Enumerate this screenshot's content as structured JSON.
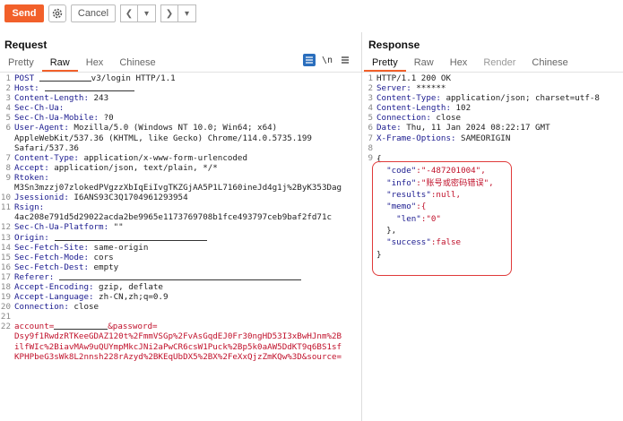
{
  "toolbar": {
    "send_label": "Send",
    "cancel_label": "Cancel",
    "icons": [
      "gear-icon",
      "back-arrow-icon",
      "back-dropdown-icon",
      "forward-arrow-icon",
      "forward-dropdown-icon"
    ]
  },
  "request": {
    "title": "Request",
    "tabs": [
      "Pretty",
      "Raw",
      "Hex",
      "Chinese"
    ],
    "active_tab": "Raw",
    "icons": [
      "wrap-lines-icon",
      "newline-icon",
      "menu-icon"
    ],
    "newline_label": "\\n",
    "line_numbers": [
      "1",
      "2",
      "3",
      "4",
      "5",
      "6",
      "",
      "",
      "7",
      "8",
      "9",
      "",
      "10",
      "11",
      "",
      "12",
      "13",
      "14",
      "15",
      "16",
      "17",
      "18",
      "19",
      "20",
      "21",
      "22",
      ""
    ],
    "lines": [
      {
        "k": "POST ",
        "v": "v3/login HTTP/1.1",
        "redact_before": 58
      },
      {
        "k": "Host:",
        "v": "",
        "redact_after": 100
      },
      {
        "k": "Content-Length:",
        "v": " 243"
      },
      {
        "k": "Sec-Ch-Ua:",
        "v": ""
      },
      {
        "k": "Sec-Ch-Ua-Mobile:",
        "v": " ?0"
      },
      {
        "k": "User-Agent:",
        "v": " Mozilla/5.0 (Windows NT 10.0; Win64; x64)"
      },
      {
        "k": "",
        "v": "AppleWebKit/537.36 (KHTML, like Gecko) Chrome/114.0.5735.199"
      },
      {
        "k": "",
        "v": "Safari/537.36"
      },
      {
        "k": "Content-Type:",
        "v": " application/x-www-form-urlencoded"
      },
      {
        "k": "Accept:",
        "v": " application/json, text/plain, */*"
      },
      {
        "k": "Rtoken:",
        "v": ""
      },
      {
        "k": "",
        "v": "M3Sn3mzzj07zlokedPVgzzXbIqEiIvgTKZGjAA5P1L7160ineJd4g1j%2ByK353Dag"
      },
      {
        "k": "Jsessionid:",
        "v": " I6ANS93C3Q1704961293954"
      },
      {
        "k": "Rsign:",
        "v": ""
      },
      {
        "k": "",
        "v": "4ac208e791d5d29022acda2be9965e1173769708b1fce493797ceb9baf2fd71c"
      },
      {
        "k": "Sec-Ch-Ua-Platform:",
        "v": " \"\""
      },
      {
        "k": "Origin:",
        "v": "",
        "redact_after": 170
      },
      {
        "k": "Sec-Fetch-Site:",
        "v": " same-origin"
      },
      {
        "k": "Sec-Fetch-Mode:",
        "v": " cors"
      },
      {
        "k": "Sec-Fetch-Dest:",
        "v": " empty"
      },
      {
        "k": "Referer:",
        "v": "",
        "redact_after": 270
      },
      {
        "k": "Accept-Encoding:",
        "v": " gzip, deflate"
      },
      {
        "k": "Accept-Language:",
        "v": " zh-CN,zh;q=0.9"
      },
      {
        "k": "Connection:",
        "v": " close"
      },
      {
        "k": "",
        "v": ""
      },
      {
        "k": "account=",
        "v": "&password=",
        "red": true,
        "redact_mid": 60
      },
      {
        "k": "",
        "v": "Dsy9f1RwdzRTKeeGDAZ120t%2FmmVSGp%2FvAsGqdEJ0Fr30ngHD53I3xBwHJnm%2B",
        "red": true
      },
      {
        "k": "",
        "v": "ilfWIc%2BiavMAw9uQUYmpMkcJNi2aPwCR6csW1Puck%2Bp5k0aAW5DdKT9q6BS1sf",
        "red": true
      },
      {
        "k": "",
        "v": "KPHPbeG3sWk8L2nnsh228rAzyd%2BKEqUbDX5%2BX%2FeXxQjzZmKQw%3D&source=",
        "red": true
      }
    ]
  },
  "response": {
    "title": "Response",
    "tabs": [
      "Pretty",
      "Raw",
      "Hex",
      "Render",
      "Chinese"
    ],
    "active_tab": "Pretty",
    "disabled_tab": "Render",
    "line_numbers": [
      "1",
      "2",
      "3",
      "4",
      "5",
      "6",
      "7",
      "8",
      "9"
    ],
    "headers": [
      {
        "k": "HTTP/1.1 200 OK",
        "v": ""
      },
      {
        "k": "Server:",
        "v": " ******"
      },
      {
        "k": "Content-Type:",
        "v": " application/json; charset=utf-8"
      },
      {
        "k": "Content-Length:",
        "v": " 102"
      },
      {
        "k": "Connection:",
        "v": " close"
      },
      {
        "k": "Date:",
        "v": " Thu, 11 Jan 2024 08:22:17 GMT"
      },
      {
        "k": "X-Frame-Options:",
        "v": " SAMEORIGIN"
      },
      {
        "k": "",
        "v": ""
      }
    ],
    "json_lines": [
      {
        "indent": "",
        "k": "{",
        "v": ""
      },
      {
        "indent": "  ",
        "k": "\"code\"",
        "v": ":\"-487201004\","
      },
      {
        "indent": "  ",
        "k": "\"info\"",
        "v": ":\"账号或密码错误\","
      },
      {
        "indent": "  ",
        "k": "\"results\"",
        "v": ":null,"
      },
      {
        "indent": "  ",
        "k": "\"memo\"",
        "v": ":{"
      },
      {
        "indent": "    ",
        "k": "\"len\"",
        "v": ":\"0\""
      },
      {
        "indent": "  ",
        "k": "},",
        "v": ""
      },
      {
        "indent": "  ",
        "k": "\"success\"",
        "v": ":false"
      },
      {
        "indent": "",
        "k": "}",
        "v": ""
      }
    ]
  },
  "colors": {
    "accent": "#f2602a",
    "header_key": "#1b1b8f",
    "body_red": "#c0102a",
    "highlight_box": "#e03a3a"
  }
}
